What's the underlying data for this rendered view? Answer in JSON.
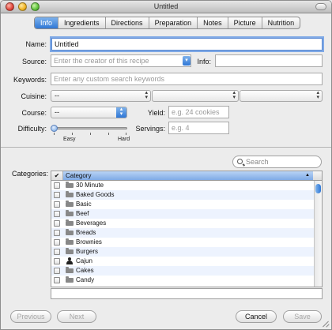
{
  "window": {
    "title": "Untitled"
  },
  "tabs": [
    {
      "label": "Info",
      "active": true
    },
    {
      "label": "Ingredients"
    },
    {
      "label": "Directions"
    },
    {
      "label": "Preparation"
    },
    {
      "label": "Notes"
    },
    {
      "label": "Picture"
    },
    {
      "label": "Nutrition"
    }
  ],
  "form": {
    "name_label": "Name:",
    "name_value": "Untitled",
    "source_label": "Source:",
    "source_placeholder": "Enter the creator of this recipe",
    "info_label": "Info:",
    "info_value": "",
    "keywords_label": "Keywords:",
    "keywords_placeholder": "Enter any custom search keywords",
    "cuisine_label": "Cuisine:",
    "cuisine_values": [
      "--",
      "",
      ""
    ],
    "course_label": "Course:",
    "course_value": "--",
    "yield_label": "Yield:",
    "yield_placeholder": "e.g. 24 cookies",
    "difficulty_label": "Difficulty:",
    "difficulty_min": "Easy",
    "difficulty_max": "Hard",
    "difficulty_level": 0,
    "servings_label": "Servings:",
    "servings_placeholder": "e.g. 4"
  },
  "categories": {
    "label": "Categories:",
    "search_placeholder": "Search",
    "header_check": "✔",
    "header_title": "Category",
    "items": [
      {
        "name": "30 Minute",
        "icon": "folder-icon"
      },
      {
        "name": "Baked Goods",
        "icon": "folder-icon"
      },
      {
        "name": "Basic",
        "icon": "folder-icon"
      },
      {
        "name": "Beef",
        "icon": "folder-icon"
      },
      {
        "name": "Beverages",
        "icon": "folder-icon"
      },
      {
        "name": "Breads",
        "icon": "folder-icon"
      },
      {
        "name": "Brownies",
        "icon": "folder-icon"
      },
      {
        "name": "Burgers",
        "icon": "folder-icon"
      },
      {
        "name": "Cajun",
        "icon": "person-icon"
      },
      {
        "name": "Cakes",
        "icon": "folder-icon"
      },
      {
        "name": "Candy",
        "icon": "folder-icon"
      }
    ]
  },
  "footer": {
    "previous": "Previous",
    "next": "Next",
    "cancel": "Cancel",
    "save": "Save"
  },
  "colors": {
    "accent": "#2f77d6",
    "placeholder": "#9a9a9a"
  }
}
